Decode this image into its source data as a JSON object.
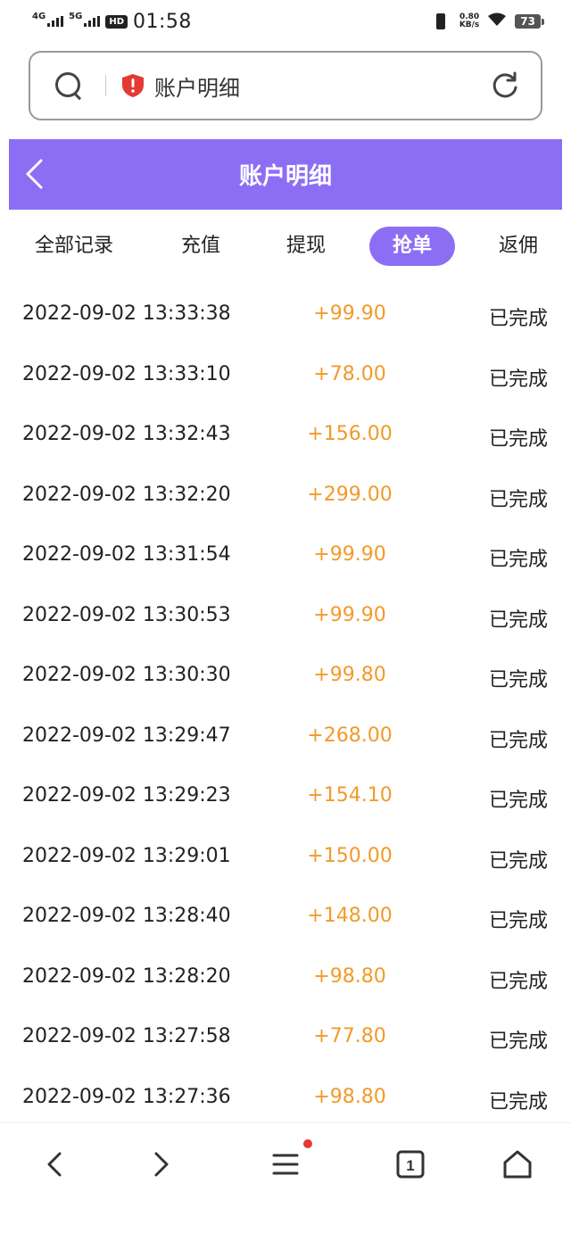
{
  "status_bar": {
    "network1": "4G",
    "network2": "5G",
    "hd": "HD",
    "time": "01:58",
    "speed_value": "0.80",
    "speed_unit": "KB/s",
    "battery": "73"
  },
  "browser": {
    "address_text": "账户明细",
    "open_tabs": "1"
  },
  "header": {
    "title": "账户明细"
  },
  "tabs": [
    {
      "label": "全部记录"
    },
    {
      "label": "充值"
    },
    {
      "label": "提现"
    },
    {
      "label": "抢单"
    },
    {
      "label": "返佣"
    }
  ],
  "active_tab": "抢单",
  "colors": {
    "accent": "#8c6ef5",
    "amount": "#f29a2a"
  },
  "records": [
    {
      "date": "2022-09-02 13:33:38",
      "amount": "+99.90",
      "status": "已完成"
    },
    {
      "date": "2022-09-02 13:33:10",
      "amount": "+78.00",
      "status": "已完成"
    },
    {
      "date": "2022-09-02 13:32:43",
      "amount": "+156.00",
      "status": "已完成"
    },
    {
      "date": "2022-09-02 13:32:20",
      "amount": "+299.00",
      "status": "已完成"
    },
    {
      "date": "2022-09-02 13:31:54",
      "amount": "+99.90",
      "status": "已完成"
    },
    {
      "date": "2022-09-02 13:30:53",
      "amount": "+99.90",
      "status": "已完成"
    },
    {
      "date": "2022-09-02 13:30:30",
      "amount": "+99.80",
      "status": "已完成"
    },
    {
      "date": "2022-09-02 13:29:47",
      "amount": "+268.00",
      "status": "已完成"
    },
    {
      "date": "2022-09-02 13:29:23",
      "amount": "+154.10",
      "status": "已完成"
    },
    {
      "date": "2022-09-02 13:29:01",
      "amount": "+150.00",
      "status": "已完成"
    },
    {
      "date": "2022-09-02 13:28:40",
      "amount": "+148.00",
      "status": "已完成"
    },
    {
      "date": "2022-09-02 13:28:20",
      "amount": "+98.80",
      "status": "已完成"
    },
    {
      "date": "2022-09-02 13:27:58",
      "amount": "+77.80",
      "status": "已完成"
    },
    {
      "date": "2022-09-02 13:27:36",
      "amount": "+98.80",
      "status": "已完成"
    }
  ]
}
